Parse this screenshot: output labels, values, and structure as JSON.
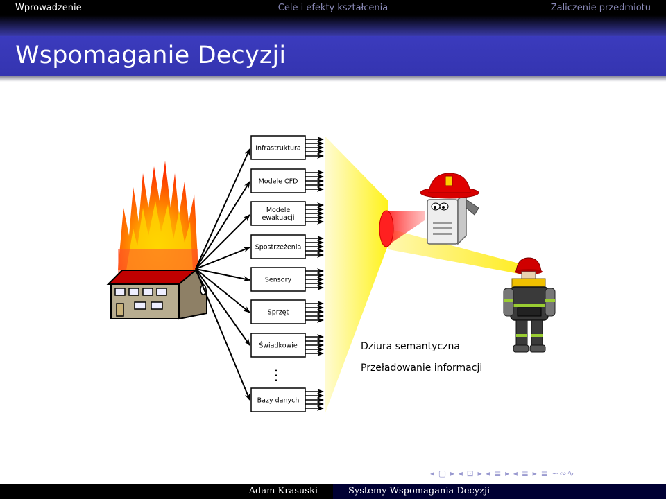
{
  "nav": {
    "items": [
      "Wprowadzenie",
      "Cele i efekty kształcenia",
      "Zaliczenie przedmiotu"
    ]
  },
  "slide": {
    "title": "Wspomaganie Decyzji"
  },
  "diagram": {
    "sources": [
      {
        "lines": [
          "Infrastruktura"
        ]
      },
      {
        "lines": [
          "Modele CFD"
        ]
      },
      {
        "lines": [
          "Modele",
          "ewakuacji"
        ]
      },
      {
        "lines": [
          "Spostrzeżenia"
        ]
      },
      {
        "lines": [
          "Sensory"
        ]
      },
      {
        "lines": [
          "Sprzęt"
        ]
      },
      {
        "lines": [
          "Świadkowie"
        ]
      },
      {
        "lines": [
          "Bazy danych"
        ]
      }
    ],
    "ellipsis": "⋮",
    "problems": [
      "Dziura semantyczna",
      "Przeładowanie informacji"
    ]
  },
  "nav_symbols": "◂ ▢ ▸ ◂ ⊡ ▸ ◂ ≣ ▸ ◂ ≣ ▸   ≣   ∽∾∿",
  "footer": {
    "author": "Adam Krasuski",
    "course": "Systemy Wspomagania Decyzji"
  }
}
